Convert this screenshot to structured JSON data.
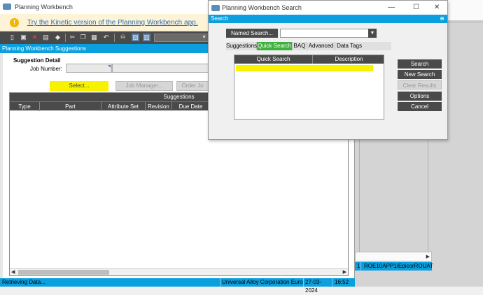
{
  "main_window": {
    "title": "Planning Workbench",
    "banner_link": "Try the Kinetic version of the Planning Workbench app.",
    "section_title": "Planning Workbench Suggestions",
    "group_label": "Suggestion Detail",
    "job_number_label": "Job Number:",
    "buttons": {
      "select": "Select...",
      "job_manager": "Job Manager...",
      "order_job": "Order Jo"
    },
    "grid": {
      "title": "Suggestions",
      "columns": [
        "Type",
        "Part",
        "Attribute Set",
        "Revision",
        "Due Date"
      ]
    }
  },
  "statusbar": {
    "message": "Retrieving Data...",
    "company": "Universal Alloy Corporation Europe",
    "date": "27-03-2024",
    "time": "16:52"
  },
  "bg_status": {
    "left": "1",
    "server": "ROE10APP1/EpicorROUAT"
  },
  "search_dialog": {
    "title": "Planning Workbench Search",
    "section_title": "Search",
    "named_search_label": "Named Search...",
    "named_search_value": "",
    "tabs": [
      "Suggestions",
      "Quick Search",
      "BAQ",
      "Advanced",
      "Data Tags"
    ],
    "active_tab": "Quick Search",
    "grid_columns": [
      "Quick Search",
      "Description"
    ],
    "side_buttons": {
      "search": "Search",
      "new_search": "New Search",
      "clear_results": "Clear Results",
      "options": "Options",
      "cancel": "Cancel"
    }
  },
  "colors": {
    "accent": "#0aa0e0",
    "highlight": "#f7f300",
    "active_tab": "#3fb13f",
    "dark": "#4a4a4a"
  }
}
